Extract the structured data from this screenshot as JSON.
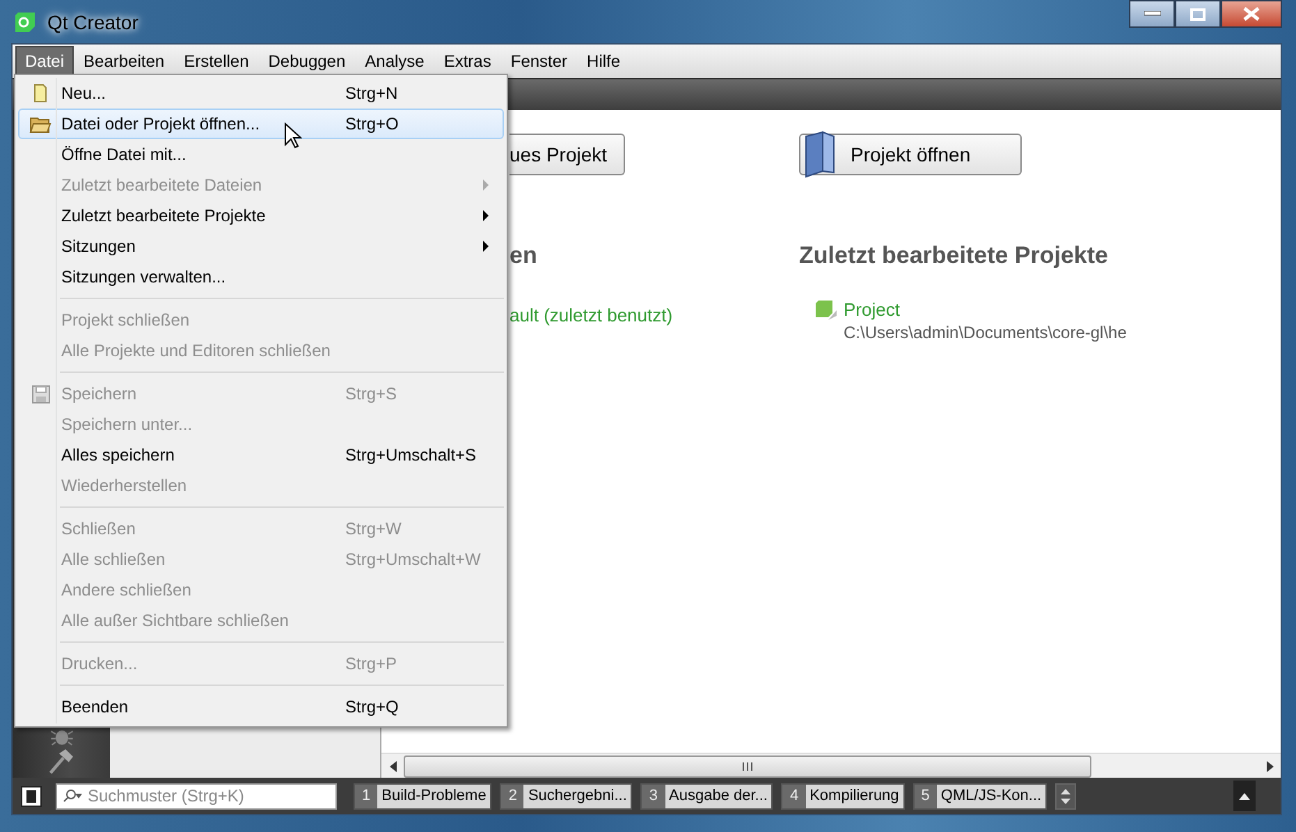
{
  "window": {
    "title": "Qt Creator"
  },
  "menubar": [
    {
      "label": "Datei",
      "selected": true
    },
    {
      "label": "Bearbeiten",
      "selected": false
    },
    {
      "label": "Erstellen",
      "selected": false
    },
    {
      "label": "Debuggen",
      "selected": false
    },
    {
      "label": "Analyse",
      "selected": false
    },
    {
      "label": "Extras",
      "selected": false
    },
    {
      "label": "Fenster",
      "selected": false
    },
    {
      "label": "Hilfe",
      "selected": false
    }
  ],
  "file_menu": [
    {
      "kind": "item",
      "label": "Neu...",
      "shortcut": "Strg+N",
      "disabled": false,
      "selected": false,
      "submenu": false
    },
    {
      "kind": "item",
      "label": "Datei oder Projekt öffnen...",
      "shortcut": "Strg+O",
      "disabled": false,
      "selected": true,
      "submenu": false
    },
    {
      "kind": "item",
      "label": "Öffne Datei mit...",
      "disabled": false,
      "selected": false,
      "submenu": false
    },
    {
      "kind": "item",
      "label": "Zuletzt bearbeitete Dateien",
      "disabled": true,
      "selected": false,
      "submenu": true
    },
    {
      "kind": "item",
      "label": "Zuletzt bearbeitete Projekte",
      "disabled": false,
      "selected": false,
      "submenu": true
    },
    {
      "kind": "item",
      "label": "Sitzungen",
      "disabled": false,
      "selected": false,
      "submenu": true
    },
    {
      "kind": "item",
      "label": "Sitzungen verwalten...",
      "disabled": false,
      "selected": false,
      "submenu": false
    },
    {
      "kind": "separator"
    },
    {
      "kind": "item",
      "label": "Projekt schließen",
      "disabled": true,
      "selected": false,
      "submenu": false
    },
    {
      "kind": "item",
      "label": "Alle Projekte und Editoren schließen",
      "disabled": true,
      "selected": false,
      "submenu": false
    },
    {
      "kind": "separator"
    },
    {
      "kind": "item",
      "label": "Speichern",
      "shortcut": "Strg+S",
      "disabled": true,
      "selected": false,
      "submenu": false
    },
    {
      "kind": "item",
      "label": "Speichern unter...",
      "disabled": true,
      "selected": false,
      "submenu": false
    },
    {
      "kind": "item",
      "label": "Alles speichern",
      "shortcut": "Strg+Umschalt+S",
      "disabled": false,
      "selected": false,
      "submenu": false
    },
    {
      "kind": "item",
      "label": "Wiederherstellen",
      "disabled": true,
      "selected": false,
      "submenu": false
    },
    {
      "kind": "separator"
    },
    {
      "kind": "item",
      "label": "Schließen",
      "shortcut": "Strg+W",
      "disabled": true,
      "selected": false,
      "submenu": false
    },
    {
      "kind": "item",
      "label": "Alle schließen",
      "shortcut": "Strg+Umschalt+W",
      "disabled": true,
      "selected": false,
      "submenu": false
    },
    {
      "kind": "item",
      "label": "Andere schließen",
      "disabled": true,
      "selected": false,
      "submenu": false
    },
    {
      "kind": "item",
      "label": "Alle außer Sichtbare schließen",
      "disabled": true,
      "selected": false,
      "submenu": false
    },
    {
      "kind": "separator"
    },
    {
      "kind": "item",
      "label": "Drucken...",
      "shortcut": "Strg+P",
      "disabled": true,
      "selected": false,
      "submenu": false
    },
    {
      "kind": "separator"
    },
    {
      "kind": "item",
      "label": "Beenden",
      "shortcut": "Strg+Q",
      "disabled": false,
      "selected": false,
      "submenu": false
    }
  ],
  "welcome": {
    "left": {
      "button": "ues Projekt",
      "heading": "en",
      "session": "ault (zuletzt benutzt)"
    },
    "right": {
      "button": "Projekt öffnen",
      "heading": "Zuletzt bearbeitete Projekte",
      "projects": [
        {
          "name": "Project",
          "path": "C:\\Users\\admin\\Documents\\core-gl\\he"
        }
      ]
    }
  },
  "output_bar": {
    "search": {
      "placeholder": "Suchmuster (Strg+K)"
    },
    "tabs": [
      {
        "number": "1",
        "label": "Build-Probleme"
      },
      {
        "number": "2",
        "label": "Suchergebni..."
      },
      {
        "number": "3",
        "label": "Ausgabe der..."
      },
      {
        "number": "4",
        "label": "Kompilierung"
      },
      {
        "number": "5",
        "label": "QML/JS-Kon..."
      }
    ]
  }
}
